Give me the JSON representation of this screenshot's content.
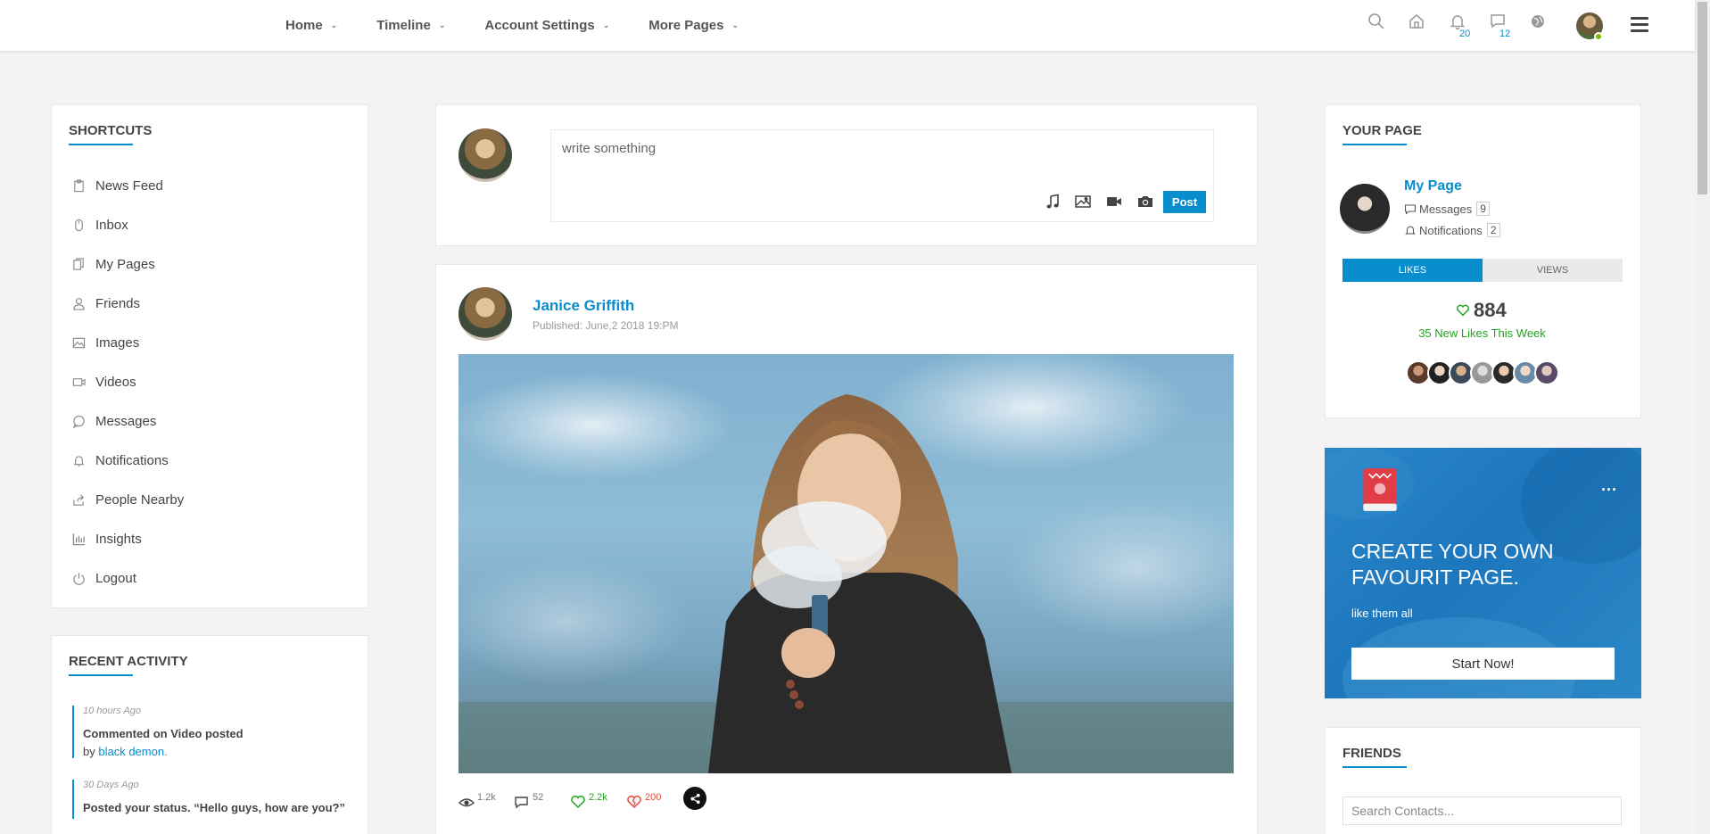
{
  "nav": {
    "items": [
      {
        "label": "Home"
      },
      {
        "label": "Timeline"
      },
      {
        "label": "Account Settings"
      },
      {
        "label": "More Pages"
      }
    ],
    "notifications_count": "20",
    "messages_count": "12"
  },
  "shortcuts": {
    "title": "Shortcuts",
    "items": [
      {
        "label": "News Feed",
        "icon": "clipboard-icon"
      },
      {
        "label": "Inbox",
        "icon": "mouse-icon"
      },
      {
        "label": "My Pages",
        "icon": "files-icon"
      },
      {
        "label": "Friends",
        "icon": "user-icon"
      },
      {
        "label": "Images",
        "icon": "image-icon"
      },
      {
        "label": "Videos",
        "icon": "video-icon"
      },
      {
        "label": "Messages",
        "icon": "chat-icon"
      },
      {
        "label": "Notifications",
        "icon": "bell-icon"
      },
      {
        "label": "People Nearby",
        "icon": "share-icon"
      },
      {
        "label": "Insights",
        "icon": "bar-chart-icon"
      },
      {
        "label": "Logout",
        "icon": "power-icon"
      }
    ]
  },
  "recent_activity": {
    "title": "Recent Activity",
    "items": [
      {
        "time": "10 hours Ago",
        "text": "Commented on Video posted",
        "by_prefix": "by",
        "by_link": "black demon."
      },
      {
        "time": "30 Days Ago",
        "text": "Posted your status. “Hello guys, how are you?”"
      }
    ]
  },
  "composer": {
    "placeholder": "write something",
    "post_label": "Post"
  },
  "post": {
    "author": "Janice Griffith",
    "published": "Published: June,2 2018 19:PM",
    "stats": {
      "views": "1.2k",
      "comments": "52",
      "likes": "2.2k",
      "dislikes": "200"
    }
  },
  "your_page": {
    "title": "Your Page",
    "page_name": "My Page",
    "messages_label": "Messages",
    "messages_count": "9",
    "notifications_label": "Notifications",
    "notifications_count": "2",
    "tabs": [
      {
        "label": "Likes"
      },
      {
        "label": "Views"
      }
    ],
    "likes_count": "884",
    "new_likes": "35 New Likes This Week"
  },
  "promo": {
    "heading_line1": "CREATE YOUR OWN",
    "heading_line2": "FAVOURIT PAGE.",
    "subtext": "like them all",
    "button_label": "Start Now!",
    "menu_label": "..."
  },
  "friends": {
    "title": "Friends",
    "search_placeholder": "Search Contacts..."
  },
  "colors": {
    "accent": "#088dcd",
    "like_green": "#21a421",
    "dislike_red": "#e44a3c"
  }
}
